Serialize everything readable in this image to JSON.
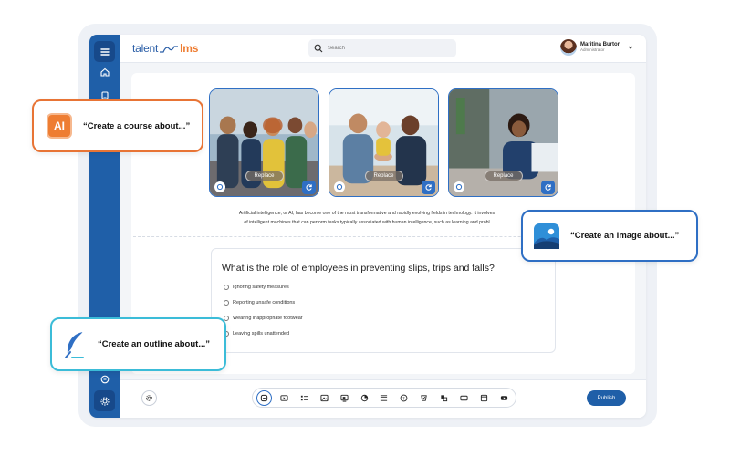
{
  "app": {
    "logo_left": "talent",
    "logo_right": "lms",
    "search_placeholder": "Search",
    "user_name": "Maritina Burton",
    "user_role": "Administrator"
  },
  "photos": [
    {
      "replace_label": "Replace"
    },
    {
      "replace_label": "Replace"
    },
    {
      "replace_label": "Replace"
    }
  ],
  "content": {
    "paragraph_line1": "Artificial intelligence, or AI, has become one of the most transformative and rapidly evolving fields in technology. It involves",
    "paragraph_line2": "of intelligent machines that can perform tasks typically associated with human intelligence, such as learning and probl"
  },
  "quiz": {
    "question": "What is the role of employees in preventing slips, trips and falls?",
    "options": [
      "Ignoring safety measures",
      "Reporting unsafe conditions",
      "Wearing inappropriate footwear",
      "Leaving spills unattended"
    ]
  },
  "toolbar": {
    "publish_label": "Publish",
    "tools": [
      "content-icon",
      "video-icon",
      "list-icon",
      "image-icon",
      "slides-icon",
      "chart-icon",
      "text-lines-icon",
      "question-icon",
      "survey-icon",
      "assignment-icon",
      "ilt-icon",
      "web-icon",
      "youtube-icon"
    ]
  },
  "callouts": {
    "ai_badge": "AI",
    "ai_text": "“Create a course about...”",
    "image_text": "“Create an image about...”",
    "outline_text": "“Create an outline about...”"
  },
  "colors": {
    "primary_blue": "#1f5fa8",
    "accent_orange": "#ee7d32",
    "accent_cyan": "#3bbcd8"
  }
}
